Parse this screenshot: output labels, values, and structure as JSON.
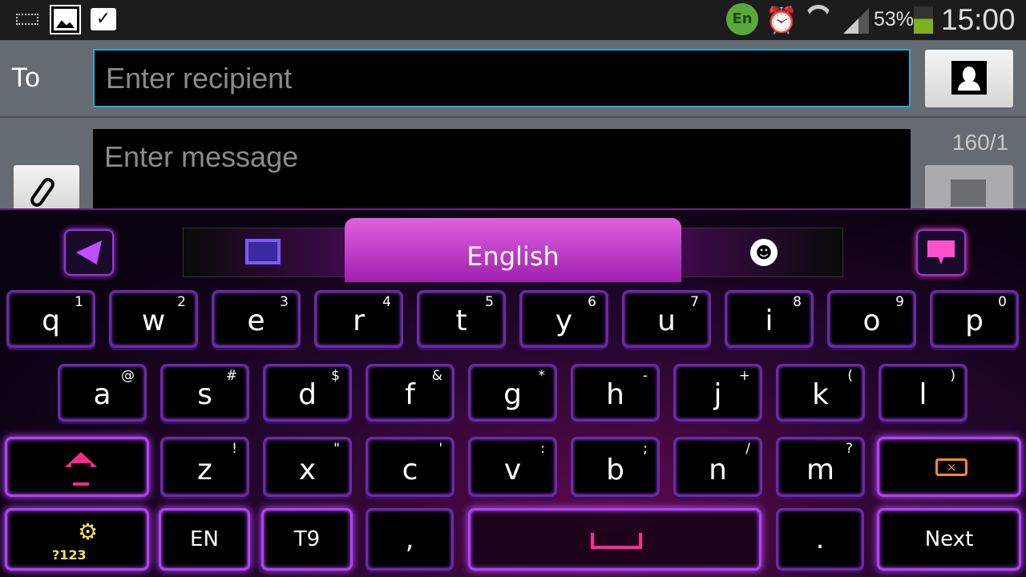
{
  "status_bar": {
    "battery": "53%",
    "time": "15:00",
    "lang_badge": "En",
    "icons": [
      "keyboard-icon",
      "gallery-icon",
      "shopping-bag-icon",
      "language-icon",
      "alarm-icon",
      "wifi-icon",
      "signal-icon",
      "battery-icon"
    ]
  },
  "compose": {
    "to_label": "To",
    "recipient_placeholder": "Enter recipient",
    "message_placeholder": "Enter message",
    "char_counter": "160/1"
  },
  "keyboard": {
    "toolbar": {
      "language": "English"
    },
    "row1": [
      {
        "k": "q",
        "s": "1"
      },
      {
        "k": "w",
        "s": "2"
      },
      {
        "k": "e",
        "s": "3"
      },
      {
        "k": "r",
        "s": "4"
      },
      {
        "k": "t",
        "s": "5"
      },
      {
        "k": "y",
        "s": "6"
      },
      {
        "k": "u",
        "s": "7"
      },
      {
        "k": "i",
        "s": "8"
      },
      {
        "k": "o",
        "s": "9"
      },
      {
        "k": "p",
        "s": "0"
      }
    ],
    "row2": [
      {
        "k": "a",
        "s": "@"
      },
      {
        "k": "s",
        "s": "#"
      },
      {
        "k": "d",
        "s": "$"
      },
      {
        "k": "f",
        "s": "&"
      },
      {
        "k": "g",
        "s": "*"
      },
      {
        "k": "h",
        "s": "-"
      },
      {
        "k": "j",
        "s": "+"
      },
      {
        "k": "k",
        "s": "("
      },
      {
        "k": "l",
        "s": ")"
      }
    ],
    "row3": [
      {
        "k": "z",
        "s": "!"
      },
      {
        "k": "x",
        "s": "\""
      },
      {
        "k": "c",
        "s": "'"
      },
      {
        "k": "v",
        "s": ":"
      },
      {
        "k": "b",
        "s": ";"
      },
      {
        "k": "n",
        "s": "/"
      },
      {
        "k": "m",
        "s": "?"
      }
    ],
    "symbols_label": "?123",
    "lang_key": "EN",
    "t9_key": "T9",
    "comma": ",",
    "period": ".",
    "next_label": "Next",
    "colors": {
      "accent": "#b040ff",
      "shift": "#ff2a8a",
      "backspace": "#ff8a20"
    }
  }
}
